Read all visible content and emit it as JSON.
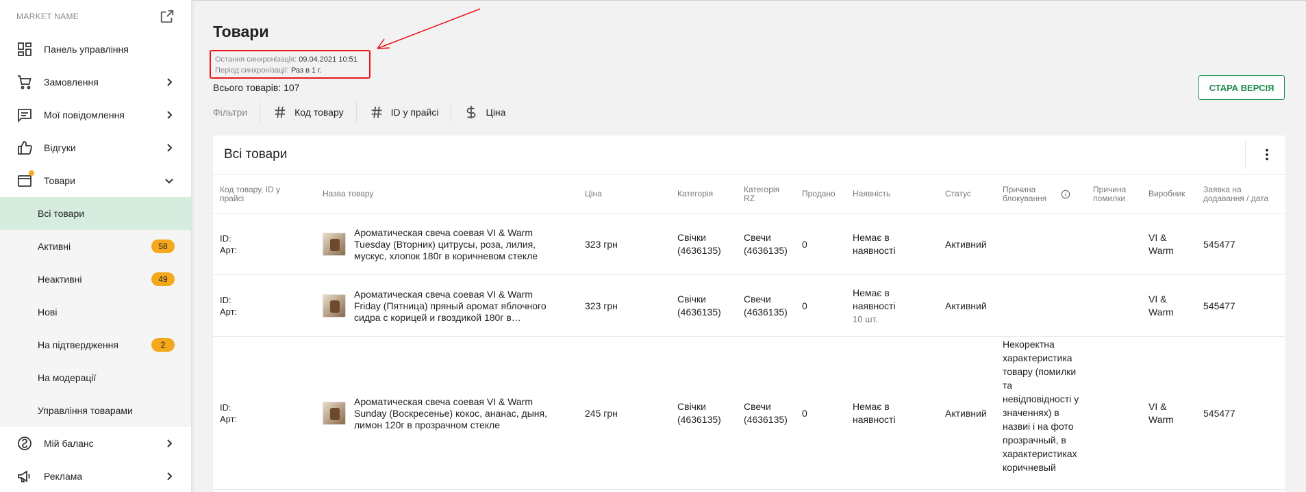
{
  "sidebar": {
    "market_name": "MARKET NAME",
    "items": [
      {
        "label": "Панель управління"
      },
      {
        "label": "Замовлення"
      },
      {
        "label": "Мої повідомлення"
      },
      {
        "label": "Відгуки"
      },
      {
        "label": "Товари"
      },
      {
        "label": "Мій баланс"
      },
      {
        "label": "Реклама"
      }
    ],
    "sub_items": [
      {
        "label": "Всі товари",
        "badge": ""
      },
      {
        "label": "Активні",
        "badge": "58"
      },
      {
        "label": "Неактивні",
        "badge": "49"
      },
      {
        "label": "Нові",
        "badge": ""
      },
      {
        "label": "На підтвердження",
        "badge": "2"
      },
      {
        "label": "На модерації",
        "badge": ""
      },
      {
        "label": "Управління товарами",
        "badge": ""
      }
    ]
  },
  "header": {
    "title": "Товари",
    "sync_last_label": "Остання синхронізація:",
    "sync_last_value": "09.04.2021 10:51",
    "sync_period_label": "Період синхронізації:",
    "sync_period_value": "Раз в 1 г.",
    "total": "Всього товарів: 107",
    "old_version": "СТАРА ВЕРСІЯ"
  },
  "filters": {
    "label": "Фільтри",
    "items": [
      {
        "label": "Код товару",
        "icon": "hash-icon"
      },
      {
        "label": "ID у прайсі",
        "icon": "hash-icon"
      },
      {
        "label": "Ціна",
        "icon": "dollar-icon"
      }
    ]
  },
  "table": {
    "title": "Всі товари",
    "headers": {
      "code": "Код товару, ID у прайсі",
      "name": "Назва товару",
      "price": "Ціна",
      "category": "Категорія",
      "category_rz": "Категорія RZ",
      "sold": "Продано",
      "availability": "Наявність",
      "status": "Статус",
      "block_reason": "Причина блокування",
      "error_reason": "Причина помилки",
      "manufacturer": "Виробник",
      "request": "Заявка на додавання / дата"
    },
    "rows": [
      {
        "id_label": "ID:",
        "art_label": "Арт:",
        "name": "Ароматическая свеча соевая VI & Warm Tuesday (Вторник) цитрусы, роза, лилия, мускус, хлопок 180г в коричневом стекле",
        "price": "323 грн",
        "category": "Свічки (4636135)",
        "category_rz": "Свечи (4636135)",
        "sold": "0",
        "availability": "Немає в наявності",
        "availability_sub": "",
        "status": "Активний",
        "block_reason": "",
        "manufacturer": "VI & Warm",
        "request": "545477"
      },
      {
        "id_label": "ID:",
        "art_label": "Арт:",
        "name": "Ароматическая свеча соевая VI & Warm Friday (Пятница) пряный аромат яблочного сидра с корицей и гвоздикой 180г в…",
        "price": "323 грн",
        "category": "Свічки (4636135)",
        "category_rz": "Свечи (4636135)",
        "sold": "0",
        "availability": "Немає в наявності",
        "availability_sub": "10 шт.",
        "status": "Активний",
        "block_reason": "",
        "manufacturer": "VI & Warm",
        "request": "545477"
      },
      {
        "id_label": "ID:",
        "art_label": "Арт:",
        "name": "Ароматическая свеча соевая VI & Warm Sunday (Воскресенье) кокос, ананас, дыня, лимон 120г в прозрачном стекле",
        "price": "245 грн",
        "category": "Свічки (4636135)",
        "category_rz": "Свечи (4636135)",
        "sold": "0",
        "availability": "Немає в наявності",
        "availability_sub": "",
        "status": "Активний",
        "block_reason": "Некоректна характеристика товару (помилки та невідповідності у значеннях) в назвиі і на фото прозрачный, в характеристиках коричневый",
        "manufacturer": "VI & Warm",
        "request": "545477"
      }
    ]
  },
  "colors": {
    "accent_green": "#1e8a47",
    "active_bg": "#d6ecde",
    "badge": "#f5a81c",
    "highlight_red": "#e8141c"
  }
}
